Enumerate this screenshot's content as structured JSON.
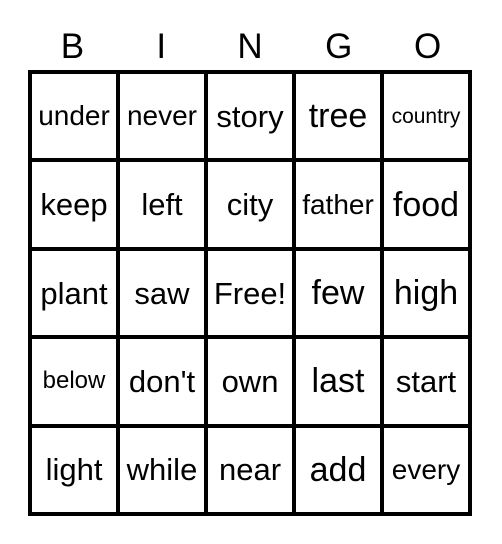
{
  "card": {
    "title": "BINGO",
    "header": {
      "letters": [
        "B",
        "I",
        "N",
        "G",
        "O"
      ]
    },
    "free_space_label": "Free!",
    "colors": {
      "border": "#000000",
      "background": "#ffffff",
      "text": "#000000"
    },
    "grid": {
      "columns": 5,
      "rows": 5,
      "cells": [
        [
          {
            "text": "under",
            "size": "md"
          },
          {
            "text": "never",
            "size": "md"
          },
          {
            "text": "story",
            "size": "lg"
          },
          {
            "text": "tree",
            "size": "xl"
          },
          {
            "text": "country",
            "size": "xs"
          }
        ],
        [
          {
            "text": "keep",
            "size": "lg"
          },
          {
            "text": "left",
            "size": "lg"
          },
          {
            "text": "city",
            "size": "lg"
          },
          {
            "text": "father",
            "size": "md"
          },
          {
            "text": "food",
            "size": "xl"
          }
        ],
        [
          {
            "text": "plant",
            "size": "lg"
          },
          {
            "text": "saw",
            "size": "lg"
          },
          {
            "text": "Free!",
            "size": "lg"
          },
          {
            "text": "few",
            "size": "xl"
          },
          {
            "text": "high",
            "size": "xl"
          }
        ],
        [
          {
            "text": "below",
            "size": "sm"
          },
          {
            "text": "don't",
            "size": "lg"
          },
          {
            "text": "own",
            "size": "lg"
          },
          {
            "text": "last",
            "size": "xl"
          },
          {
            "text": "start",
            "size": "lg"
          }
        ],
        [
          {
            "text": "light",
            "size": "lg"
          },
          {
            "text": "while",
            "size": "lg"
          },
          {
            "text": "near",
            "size": "lg"
          },
          {
            "text": "add",
            "size": "xl"
          },
          {
            "text": "every",
            "size": "md"
          }
        ]
      ]
    }
  }
}
